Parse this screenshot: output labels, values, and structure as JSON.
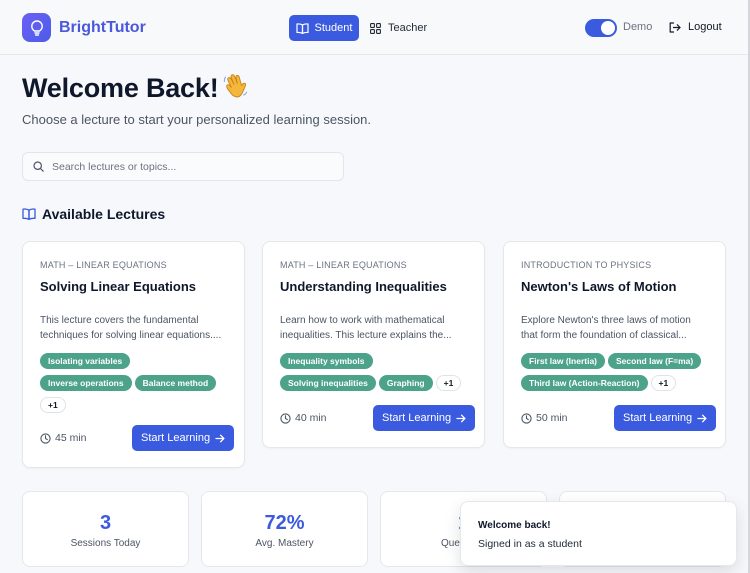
{
  "header": {
    "brand": "BrightTutor",
    "nav": {
      "student": "Student",
      "teacher": "Teacher"
    },
    "demo_label": "Demo",
    "demo_enabled": true,
    "logout": "Logout"
  },
  "hero": {
    "title": "Welcome Back!",
    "emoji": "👋",
    "subtitle": "Choose a lecture to start your personalized learning session."
  },
  "search": {
    "placeholder": "Search lectures or topics..."
  },
  "lectures_section": {
    "title": "Available Lectures"
  },
  "lectures": [
    {
      "category": "MATH – LINEAR EQUATIONS",
      "title": "Solving Linear Equations",
      "desc_line1": "This lecture covers the fundamental",
      "desc_line2": "techniques for solving linear equations....",
      "tags": [
        "Isolating variables",
        "Inverse operations",
        "Balance method"
      ],
      "more": "+1",
      "duration": "45 min",
      "cta": "Start Learning"
    },
    {
      "category": "MATH – LINEAR EQUATIONS",
      "title": "Understanding Inequalities",
      "desc_line1": "Learn how to work with mathematical",
      "desc_line2": "inequalities. This lecture explains the...",
      "tags": [
        "Inequality symbols",
        "Solving inequalities",
        "Graphing"
      ],
      "more": "+1",
      "duration": "40 min",
      "cta": "Start Learning"
    },
    {
      "category": "INTRODUCTION TO PHYSICS",
      "title": "Newton's Laws of Motion",
      "desc_line1": "Explore Newton's three laws of motion",
      "desc_line2": "that form the foundation of classical...",
      "tags": [
        "First law (Inertia)",
        "Second law (F=ma)",
        "Third law (Action-Reaction)"
      ],
      "more": "+1",
      "duration": "50 min",
      "cta": "Start Learning"
    }
  ],
  "stats": [
    {
      "value": "3",
      "label": "Sessions Today"
    },
    {
      "value": "72%",
      "label": "Avg. Mastery"
    },
    {
      "value": "1",
      "label": "Questions"
    },
    {
      "value": "",
      "label": ""
    }
  ],
  "toast": {
    "title": "Welcome back!",
    "message": "Signed in as a student"
  },
  "colors": {
    "primary": "#3a5bdf",
    "brand": "#4a58dc",
    "tag": "#4ca389"
  }
}
